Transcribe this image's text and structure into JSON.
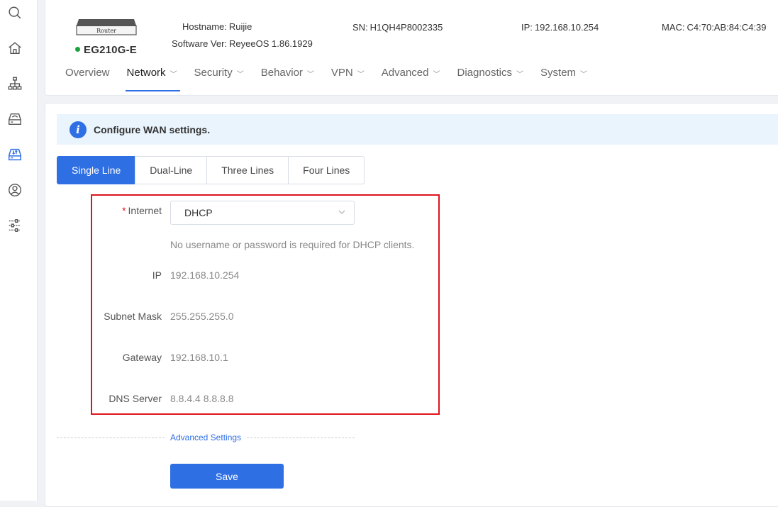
{
  "device": {
    "image_label": "Router",
    "model": "EG210G-E",
    "hostname_label": "Hostname:",
    "hostname": "Ruijie",
    "software_label": "Software Ver:",
    "software": "ReyeeOS 1.86.1929",
    "sn_label": "SN:",
    "sn": "H1QH4P8002335",
    "ip_label": "IP:",
    "ip": "192.168.10.254",
    "mac_label": "MAC:",
    "mac": "C4:70:AB:84:C4:39"
  },
  "nav": {
    "items": [
      {
        "label": "Overview",
        "dropdown": false
      },
      {
        "label": "Network",
        "dropdown": true,
        "active": true
      },
      {
        "label": "Security",
        "dropdown": true
      },
      {
        "label": "Behavior",
        "dropdown": true
      },
      {
        "label": "VPN",
        "dropdown": true
      },
      {
        "label": "Advanced",
        "dropdown": true
      },
      {
        "label": "Diagnostics",
        "dropdown": true
      },
      {
        "label": "System",
        "dropdown": true
      }
    ]
  },
  "notice": {
    "text": "Configure WAN settings."
  },
  "tabs": [
    "Single Line",
    "Dual-Line",
    "Three Lines",
    "Four Lines"
  ],
  "form": {
    "internet_required_mark": "*",
    "internet_label": "Internet",
    "internet_value": "DHCP",
    "hint": "No username or password is required for DHCP clients.",
    "ip_label": "IP",
    "ip_value": "192.168.10.254",
    "mask_label": "Subnet Mask",
    "mask_value": "255.255.255.0",
    "gateway_label": "Gateway",
    "gateway_value": "192.168.10.1",
    "dns_label": "DNS Server",
    "dns_value": "8.8.4.4 8.8.8.8",
    "advanced_label": "Advanced Settings",
    "save_label": "Save"
  },
  "rail": {
    "icons": [
      "search-icon",
      "home-icon",
      "network-topology-icon",
      "router-icon",
      "gateway-device-icon",
      "user-icon",
      "settings-sliders-icon"
    ]
  },
  "colors": {
    "accent": "#2f6fe4",
    "highlight": "#e0141e",
    "status_online": "#1aa33a"
  }
}
